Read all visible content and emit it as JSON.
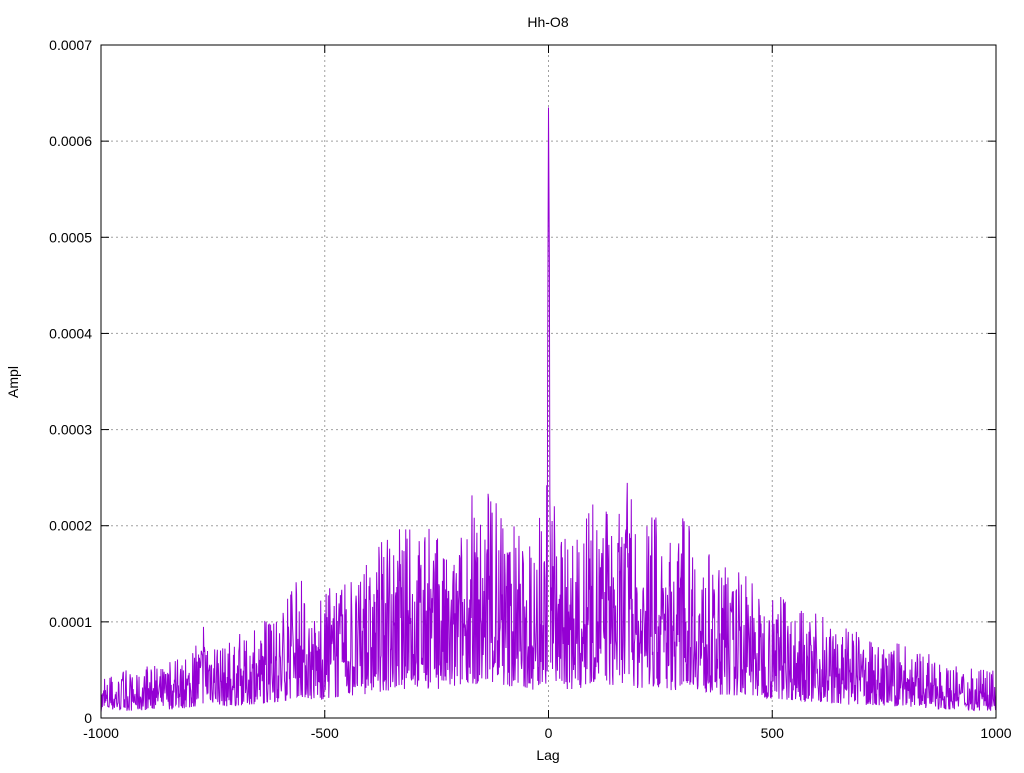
{
  "chart_data": {
    "type": "line",
    "title": "Hh-O8",
    "xlabel": "Lag",
    "ylabel": "Ampl",
    "xlim": [
      -1000,
      1000
    ],
    "ylim": [
      0,
      0.0007
    ],
    "xticks": [
      -1000,
      -500,
      0,
      500,
      1000
    ],
    "xtick_labels": [
      "-1000",
      "-500",
      "0",
      "500",
      "1000"
    ],
    "yticks": [
      0,
      0.0001,
      0.0002,
      0.0003,
      0.0004,
      0.0005,
      0.0006,
      0.0007
    ],
    "ytick_labels": [
      "0",
      "0.0001",
      "0.0002",
      "0.0003",
      "0.0004",
      "0.0005",
      "0.0006",
      "0.0007"
    ],
    "grid": true,
    "series": [
      {
        "color": "#9400d3",
        "x": [
          -1000,
          -960,
          -920,
          -880,
          -840,
          -800,
          -760,
          -720,
          -680,
          -640,
          -600,
          -560,
          -520,
          -480,
          -440,
          -400,
          -360,
          -320,
          -300,
          -280,
          -260,
          -240,
          -220,
          -200,
          -180,
          -160,
          -140,
          -120,
          -100,
          -80,
          -60,
          -40,
          -20,
          -10,
          -5,
          -2,
          0,
          2,
          5,
          10,
          20,
          40,
          60,
          80,
          100,
          120,
          140,
          160,
          180,
          200,
          220,
          240,
          260,
          280,
          300,
          320,
          340,
          360,
          380,
          400,
          440,
          480,
          520,
          560,
          600,
          640,
          680,
          720,
          760,
          800,
          840,
          880,
          920,
          960,
          1000
        ],
        "y": [
          4e-05,
          5e-05,
          5e-05,
          6e-05,
          6e-05,
          7e-05,
          0.00011,
          8e-05,
          9e-05,
          0.0001,
          0.00011,
          0.00015,
          0.00012,
          0.00014,
          0.00015,
          0.00017,
          0.00019,
          0.0002,
          0.00021,
          0.00022,
          0.00019,
          0.0002,
          0.00018,
          0.00021,
          0.00025,
          0.00023,
          0.00024,
          0.00023,
          0.00021,
          0.00022,
          0.0002,
          0.00019,
          0.00021,
          0.00022,
          0.00024,
          0.00036,
          0.000635,
          0.00047,
          0.0003,
          0.00023,
          0.00021,
          0.0002,
          0.00019,
          0.00021,
          0.00025,
          0.00023,
          0.00022,
          0.00024,
          0.00025,
          0.0002,
          0.00022,
          0.00021,
          0.0002,
          0.00019,
          0.00021,
          0.000235,
          0.00018,
          0.00017,
          0.00016,
          0.00016,
          0.00015,
          0.00014,
          0.00013,
          0.00012,
          0.00011,
          0.0001,
          9e-05,
          9e-05,
          8e-05,
          8e-05,
          7e-05,
          6e-05,
          6e-05,
          5e-05,
          5e-05
        ]
      }
    ]
  }
}
